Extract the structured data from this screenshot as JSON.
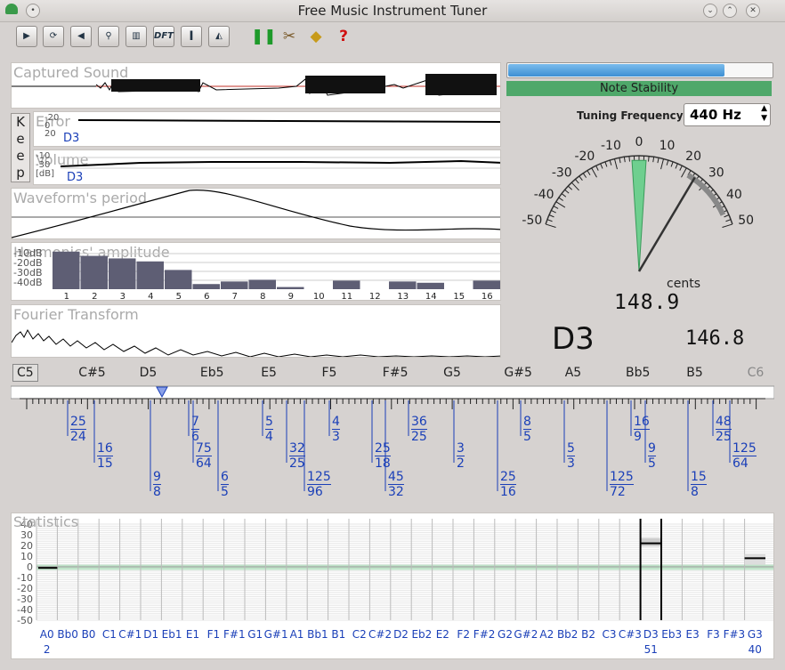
{
  "window": {
    "title": "Free Music Instrument Tuner"
  },
  "toolbar": {
    "tools": [
      {
        "name": "record-sound-icon",
        "label": ""
      },
      {
        "name": "refresh-icon",
        "label": ""
      },
      {
        "name": "speaker-icon",
        "label": ""
      },
      {
        "name": "zoom-icon",
        "label": ""
      },
      {
        "name": "spectrum-icon",
        "label": ""
      },
      {
        "name": "dft-icon",
        "label": "DFT"
      },
      {
        "name": "info-icon",
        "label": "I"
      },
      {
        "name": "waveform-icon",
        "label": ""
      }
    ]
  },
  "panels": {
    "captured_sound": "Captured Sound",
    "error": "Error",
    "volume": "Volume",
    "waveform_period": "Waveform's period",
    "harmonics": "Harmonics' amplitude",
    "fourier": "Fourier Transform",
    "statistics": "Statistics"
  },
  "keep": [
    "K",
    "e",
    "e",
    "p"
  ],
  "error_axis": [
    "-20",
    "0",
    "20"
  ],
  "error_note": "D3",
  "volume_axis": [
    "-10",
    "-30",
    "[dB]"
  ],
  "volume_note": "D3",
  "harmonic_axis": [
    "-10dB",
    "-20dB",
    "-30dB",
    "-40dB"
  ],
  "harmonics": {
    "numbers": [
      "1",
      "2",
      "3",
      "4",
      "5",
      "6",
      "7",
      "8",
      "9",
      "10",
      "11",
      "12",
      "13",
      "14",
      "15",
      "16"
    ],
    "levels": [
      0.88,
      0.78,
      0.72,
      0.65,
      0.45,
      0.12,
      0.18,
      0.22,
      0.05,
      0.0,
      0.2,
      0.0,
      0.18,
      0.15,
      0.0,
      0.2
    ]
  },
  "stability": {
    "label": "Note Stability",
    "level": 0.82
  },
  "tuning": {
    "label": "Tuning Frequency",
    "value": "440 Hz"
  },
  "meter": {
    "scale": [
      "-50",
      "-40",
      "-30",
      "-20",
      "-10",
      "0",
      "10",
      "20",
      "30",
      "40",
      "50"
    ],
    "unit": "cents",
    "needle_cents": 25,
    "frequency": "148.9",
    "note": "D3",
    "reference_frequency": "146.8"
  },
  "keyboard": {
    "notes": [
      "C5",
      "C#5",
      "D5",
      "Eb5",
      "E5",
      "F5",
      "F#5",
      "G5",
      "G#5",
      "A5",
      "Bb5",
      "B5",
      "C6"
    ],
    "ratios": [
      {
        "num": "25",
        "den": "24"
      },
      {
        "num": "16",
        "den": "15"
      },
      {
        "num": "9",
        "den": "8"
      },
      {
        "num": "7",
        "den": "6"
      },
      {
        "num": "75",
        "den": "64"
      },
      {
        "num": "6",
        "den": "5"
      },
      {
        "num": "5",
        "den": "4"
      },
      {
        "num": "32",
        "den": "25"
      },
      {
        "num": "125",
        "den": "96"
      },
      {
        "num": "4",
        "den": "3"
      },
      {
        "num": "25",
        "den": "18"
      },
      {
        "num": "45",
        "den": "32"
      },
      {
        "num": "36",
        "den": "25"
      },
      {
        "num": "3",
        "den": "2"
      },
      {
        "num": "25",
        "den": "16"
      },
      {
        "num": "8",
        "den": "5"
      },
      {
        "num": "5",
        "den": "3"
      },
      {
        "num": "125",
        "den": "72"
      },
      {
        "num": "16",
        "den": "9"
      },
      {
        "num": "9",
        "den": "5"
      },
      {
        "num": "15",
        "den": "8"
      },
      {
        "num": "48",
        "den": "25"
      },
      {
        "num": "125",
        "den": "64"
      }
    ]
  },
  "statistics": {
    "yaxis": [
      "40",
      "30",
      "20",
      "10",
      "0",
      "-10",
      "-20",
      "-30",
      "-40",
      "-50"
    ],
    "notes": [
      "A0",
      "Bb0",
      "B0",
      "C1",
      "C#1",
      "D1",
      "Eb1",
      "E1",
      "F1",
      "F#1",
      "G1",
      "G#1",
      "A1",
      "Bb1",
      "B1",
      "C2",
      "C#2",
      "D2",
      "Eb2",
      "E2",
      "F2",
      "F#2",
      "G2",
      "G#2",
      "A2",
      "Bb2",
      "B2",
      "C3",
      "C#3",
      "D3",
      "Eb3",
      "E3",
      "F3",
      "F#3",
      "G3"
    ],
    "counts": {
      "A0": "2",
      "D3": "51",
      "G3": "40"
    }
  }
}
